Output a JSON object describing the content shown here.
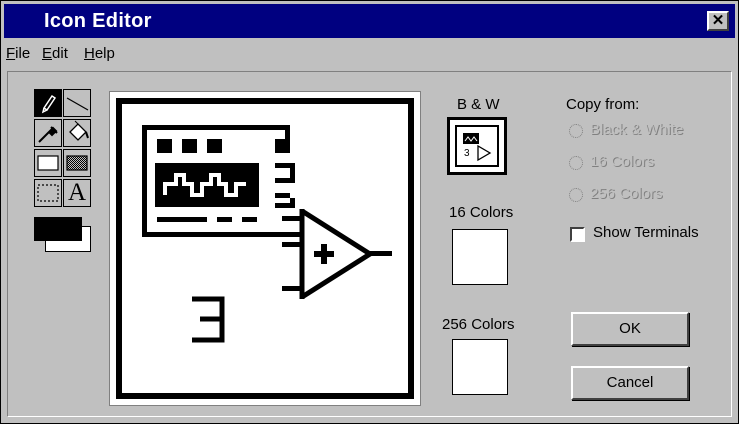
{
  "window": {
    "title": "Icon Editor",
    "close_glyph": "✕"
  },
  "menu": [
    {
      "label": "File",
      "hotkey": "F",
      "rest": "ile"
    },
    {
      "label": "Edit",
      "hotkey": "E",
      "rest": "dit"
    },
    {
      "label": "Help",
      "hotkey": "H",
      "rest": "elp"
    }
  ],
  "tools": [
    {
      "name": "pencil-tool-icon",
      "selected": true
    },
    {
      "name": "line-tool-icon",
      "selected": false
    },
    {
      "name": "dropper-tool-icon",
      "selected": false
    },
    {
      "name": "fill-bucket-tool-icon",
      "selected": false
    },
    {
      "name": "rectangle-tool-icon",
      "selected": false
    },
    {
      "name": "filled-rectangle-tool-icon",
      "selected": false
    },
    {
      "name": "select-tool-icon",
      "selected": false
    },
    {
      "name": "text-tool-icon",
      "selected": false
    }
  ],
  "colors": {
    "foreground": "#000000",
    "background": "#ffffff"
  },
  "canvas": {
    "glyph": "3"
  },
  "previews": {
    "bw_label": "B & W",
    "bw_glyph": "3",
    "sixteen_label": "16 Colors",
    "c256_label": "256 Colors"
  },
  "copy_from": {
    "label": "Copy from:",
    "options": [
      "Black & White",
      "16 Colors",
      "256 Colors"
    ]
  },
  "show_terminals": {
    "label": "Show Terminals",
    "checked": false
  },
  "buttons": {
    "ok": "OK",
    "cancel": "Cancel"
  },
  "text_tool_glyph": "A"
}
